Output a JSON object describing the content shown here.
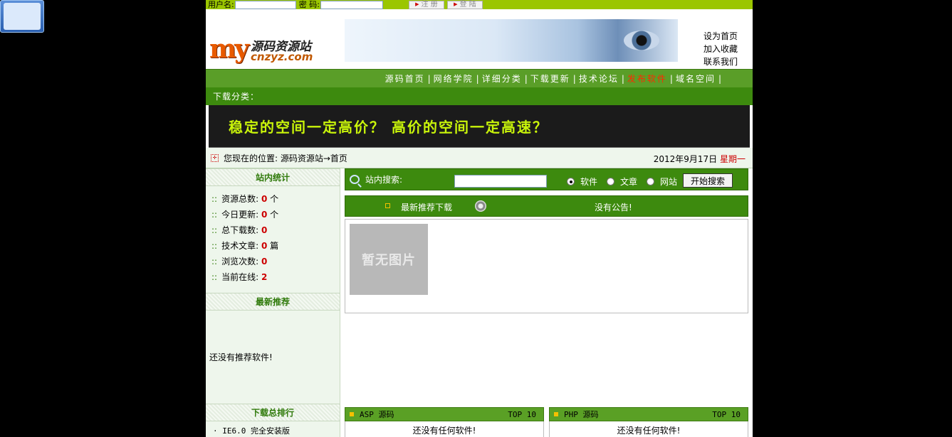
{
  "login": {
    "username_label": "用户名:",
    "password_label": "密  码:",
    "register_label": "注 册",
    "login_label": "登 陆"
  },
  "logo": {
    "mark": "my",
    "cn_name": "源码资源站",
    "domain": "cnzyz.com"
  },
  "header_links": [
    "设为首页",
    "加入收藏",
    "联系我们"
  ],
  "nav": {
    "items": [
      "源码首页",
      "网络学院",
      "详细分类",
      "下载更新",
      "技术论坛",
      "发布软件",
      "域名空间"
    ],
    "highlight_index": 5,
    "separator": "|"
  },
  "category_bar": "下载分类：",
  "slogan": "稳定的空间一定高价？  高价的空间一定高速？",
  "location": {
    "text": "您现在的位置: 源码资源站→首页",
    "date": "2012年9月17日",
    "weekday": "星期一"
  },
  "stats": {
    "title": "站内统计",
    "rows": [
      {
        "label": "资源总数: ",
        "value": "0",
        "unit": " 个"
      },
      {
        "label": "今日更新: ",
        "value": "0",
        "unit": " 个"
      },
      {
        "label": "总下载数: ",
        "value": "0",
        "unit": ""
      },
      {
        "label": "技术文章: ",
        "value": "0",
        "unit": " 篇"
      },
      {
        "label": "浏览次数: ",
        "value": "0",
        "unit": ""
      },
      {
        "label": "当前在线: ",
        "value": "2",
        "unit": ""
      }
    ],
    "bullet": "::"
  },
  "recommend": {
    "title": "最新推荐",
    "empty": "还没有推荐软件!"
  },
  "ranking": {
    "title": "下载总排行",
    "items": [
      "IE6.0 完全安装版"
    ]
  },
  "search": {
    "label": "站内搜索:",
    "value": "",
    "options": [
      "软件",
      "文章",
      "网站"
    ],
    "selected": 0,
    "button": "开始搜索"
  },
  "news": {
    "latest_label": "最新推荐下载",
    "notice": "没有公告!"
  },
  "no_image_label": "暂无图片",
  "code_boxes": [
    {
      "title": "ASP 源码",
      "top": "TOP 10",
      "empty": "还没有任何软件!"
    },
    {
      "title": "PHP 源码",
      "top": "TOP 10",
      "empty": "还没有任何软件!"
    }
  ],
  "colors": {
    "top_bar": "#9bc600",
    "nav": "#5a9e28",
    "nav_dark": "#3d8a0e",
    "accent_red": "#cc0000",
    "slogan": "#c9f40a"
  }
}
